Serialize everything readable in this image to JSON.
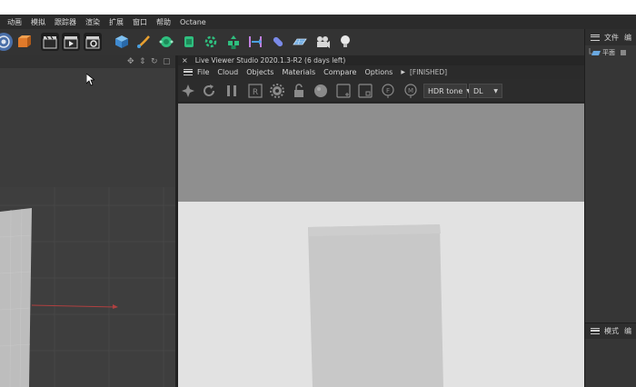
{
  "main_menu": [
    "动画",
    "模拟",
    "跟踪器",
    "渲染",
    "扩展",
    "窗口",
    "帮助",
    "Octane"
  ],
  "toolbar": {
    "icons": [
      "camera-icon",
      "cube-icon",
      "clapboard-icon",
      "render-view-icon",
      "render-settings-icon",
      "primitive-cube-icon",
      "pen-icon",
      "subdivision-icon",
      "deformer-icon",
      "array-icon",
      "effector-icon",
      "cloner-icon",
      "tracer-icon",
      "capsule-icon",
      "floor-icon",
      "camera-object-icon",
      "light-icon"
    ]
  },
  "right_panel": {
    "header_items": [
      "文件",
      "编"
    ],
    "tree_row": "平面",
    "footer_items": [
      "模式",
      "编"
    ]
  },
  "viewport": {
    "nav_icons": [
      "move-view-icon",
      "pan-view-icon",
      "rotate-view-icon",
      "maximize-view-icon"
    ]
  },
  "live_viewer": {
    "close_label": "×",
    "title": "Live Viewer Studio 2020.1.3-R2 (6 days left)",
    "menu": [
      "File",
      "Cloud",
      "Objects",
      "Materials",
      "Compare",
      "Options"
    ],
    "status": "[FINISHED]",
    "tone_dropdown": "HDR tone",
    "mode_dropdown": "DL",
    "tool_icons": [
      "send-scene-icon",
      "restart-icon",
      "pause-icon",
      "region-render-icon",
      "settings-gear-icon",
      "lock-icon",
      "material-ball-icon",
      "add-box-icon",
      "clay-mode-icon",
      "focus-picker-icon",
      "material-picker-icon"
    ]
  },
  "colors": {
    "app_bg": "#2b2b2b",
    "viewer_top": "#8f8f8f",
    "viewer_bottom": "#e2e2e2",
    "plane": "#c8c8c8",
    "axis_red": "#b04040"
  }
}
